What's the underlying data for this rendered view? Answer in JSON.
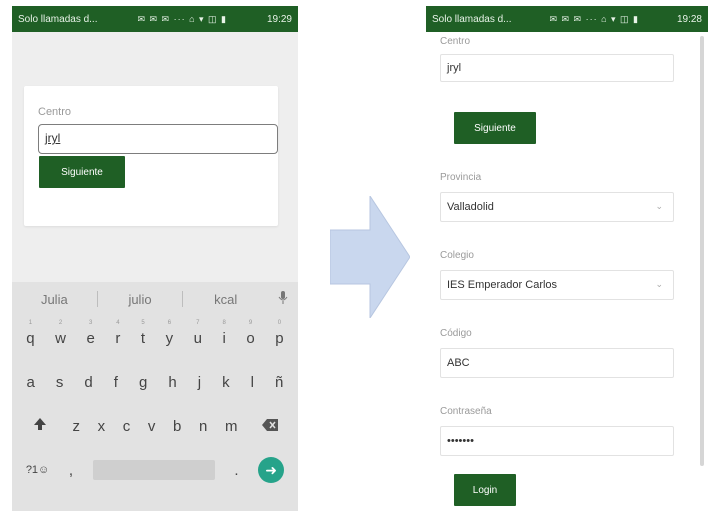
{
  "statusbar": {
    "text": "Solo llamadas d...",
    "icons": "✉ ✉ ✉ ··· ⌂ ▾ ◫ ▮",
    "time": "19:29",
    "time_right": "19:28"
  },
  "left_screen": {
    "centro_label": "Centro",
    "centro_value": "jryl",
    "next_label": "Siguiente"
  },
  "keyboard": {
    "suggestions": [
      "Julia",
      "julio",
      "kcal"
    ],
    "row1": [
      "q",
      "w",
      "e",
      "r",
      "t",
      "y",
      "u",
      "i",
      "o",
      "p"
    ],
    "row1_hints": [
      "1",
      "2",
      "3",
      "4",
      "5",
      "6",
      "7",
      "8",
      "9",
      "0"
    ],
    "row2": [
      "a",
      "s",
      "d",
      "f",
      "g",
      "h",
      "j",
      "k",
      "l",
      "ñ"
    ],
    "row3": [
      "z",
      "x",
      "c",
      "v",
      "b",
      "n",
      "m"
    ],
    "symbols_key": "?1☺",
    "comma_key": ",",
    "period_key": ".",
    "mic_icon": "mic-icon",
    "shift_icon": "shift-icon",
    "backspace_icon": "backspace-icon",
    "enter_icon": "arrow-right-icon"
  },
  "right_screen": {
    "centro_label": "Centro",
    "centro_value": "jryl",
    "next_label": "Siguiente",
    "provincia_label": "Provincia",
    "provincia_value": "Valladolid",
    "colegio_label": "Colegio",
    "colegio_value": "IES Emperador Carlos",
    "codigo_label": "Código",
    "codigo_value": "ABC",
    "password_label": "Contraseña",
    "password_value": "•••••••",
    "login_label": "Login"
  },
  "colors": {
    "brand_green": "#1f5f25",
    "arrow_fill": "#c9d7ee",
    "enter_key": "#26a38a"
  }
}
